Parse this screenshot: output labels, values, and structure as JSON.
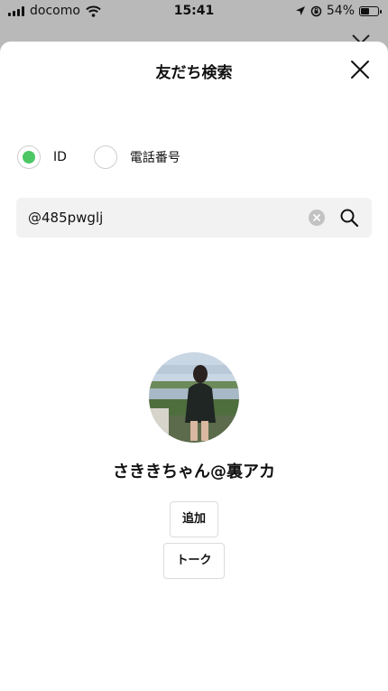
{
  "status_bar": {
    "carrier": "docomo",
    "time": "15:41",
    "battery": "54%",
    "battery_level": 0.54
  },
  "sheet": {
    "title": "友だち検索",
    "close_icon": "close-icon"
  },
  "search_type": {
    "selected": "ID",
    "options": [
      "ID",
      "電話番号"
    ],
    "accent_color": "#4cc764"
  },
  "search": {
    "value": "@485pwglj",
    "clear_icon": "clear-icon",
    "search_icon": "search-icon"
  },
  "result": {
    "name": "さききちゃん@裏アカ",
    "add_label": "追加",
    "talk_label": "トーク"
  }
}
